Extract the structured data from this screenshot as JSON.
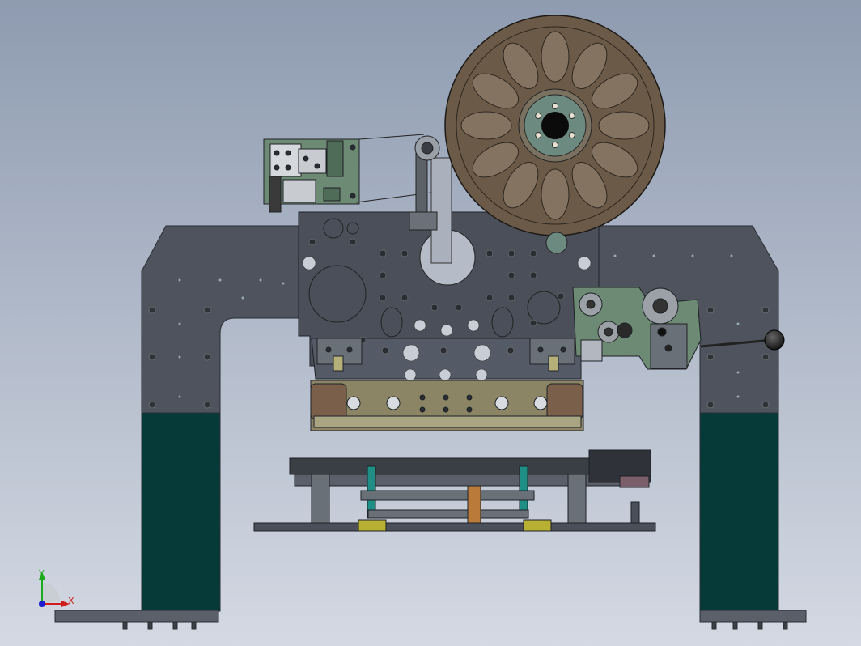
{
  "viewport": {
    "background_top": "#8e9bb0",
    "background_bottom": "#d4d9e3"
  },
  "colors": {
    "frame": "#4e535d",
    "frame_edge": "#2a2d33",
    "leg": "#063a39",
    "plate": "#4a4f5a",
    "reel_outer": "#6b5a47",
    "reel_slot": "#857361",
    "hub": "#6d8a80",
    "bracket_green": "#6d8a74",
    "bar_olive": "#8b8566",
    "cyan": "#1f8f86",
    "yellow": "#b8b032",
    "orange": "#b97a3a"
  },
  "triad": {
    "x_label": "X",
    "y_label": "Y",
    "x_color": "#d11c1c",
    "y_color": "#1aaa1a",
    "z_color": "#1c1cd1"
  },
  "icons": {
    "orientation": "coordinate-triad-icon",
    "handle": "lever-knob-icon"
  }
}
